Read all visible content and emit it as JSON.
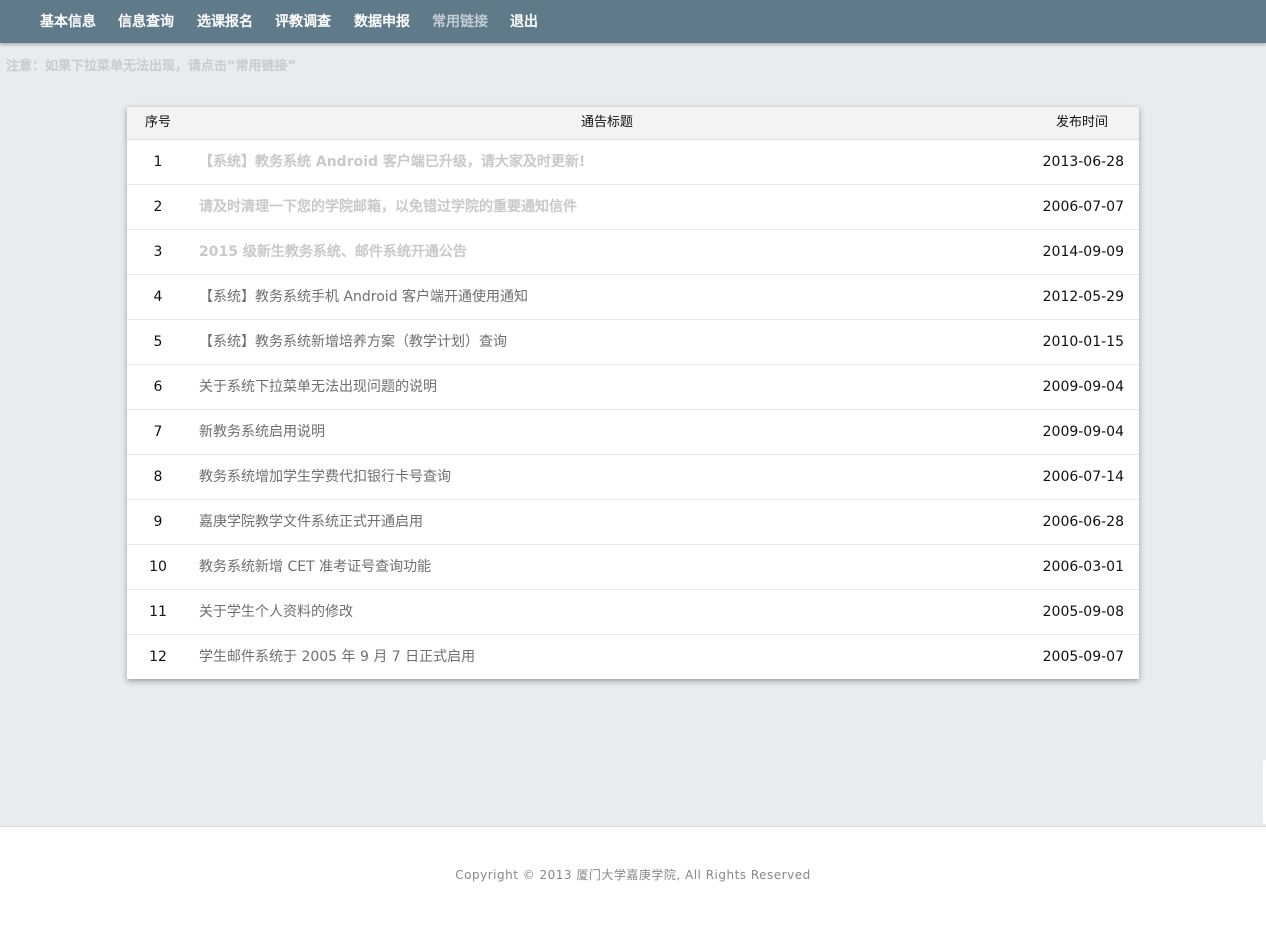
{
  "nav": {
    "items": [
      {
        "label": "基本信息",
        "muted": false
      },
      {
        "label": "信息查询",
        "muted": false
      },
      {
        "label": "选课报名",
        "muted": false
      },
      {
        "label": "评教调查",
        "muted": false
      },
      {
        "label": "数据申报",
        "muted": false
      },
      {
        "label": "常用链接",
        "muted": true
      },
      {
        "label": "退出",
        "muted": false
      }
    ]
  },
  "notice": "注意：如果下拉菜单无法出现，请点击“常用链接”",
  "table": {
    "headers": {
      "num": "序号",
      "title": "通告标题",
      "date": "发布时间"
    },
    "rows": [
      {
        "num": "1",
        "title": "【系统】教务系统 Android 客户端已升级，请大家及时更新!",
        "date": "2013-06-28",
        "faded": true
      },
      {
        "num": "2",
        "title": "请及时清理一下您的学院邮箱，以免错过学院的重要通知信件",
        "date": "2006-07-07",
        "faded": true
      },
      {
        "num": "3",
        "title": "2015 级新生教务系统、邮件系统开通公告",
        "date": "2014-09-09",
        "faded": true
      },
      {
        "num": "4",
        "title": "【系统】教务系统手机 Android 客户端开通使用通知",
        "date": "2012-05-29",
        "faded": false
      },
      {
        "num": "5",
        "title": "【系统】教务系统新增培养方案（教学计划）查询",
        "date": "2010-01-15",
        "faded": false
      },
      {
        "num": "6",
        "title": "关于系统下拉菜单无法出现问题的说明",
        "date": "2009-09-04",
        "faded": false
      },
      {
        "num": "7",
        "title": "新教务系统启用说明",
        "date": "2009-09-04",
        "faded": false
      },
      {
        "num": "8",
        "title": "教务系统增加学生学费代扣银行卡号查询",
        "date": "2006-07-14",
        "faded": false
      },
      {
        "num": "9",
        "title": "嘉庚学院教学文件系统正式开通启用",
        "date": "2006-06-28",
        "faded": false
      },
      {
        "num": "10",
        "title": "教务系统新增 CET 准考证号查询功能",
        "date": "2006-03-01",
        "faded": false
      },
      {
        "num": "11",
        "title": "关于学生个人资料的修改",
        "date": "2005-09-08",
        "faded": false
      },
      {
        "num": "12",
        "title": "学生邮件系统于 2005 年 9 月 7 日正式启用",
        "date": "2005-09-07",
        "faded": false
      }
    ]
  },
  "footer": "Copyright © 2013 厦门大学嘉庚学院, All Rights Reserved",
  "colors": {
    "navbar": "#5f7a89",
    "page_background": "#e8ecef",
    "link_text": "#6f6f6f",
    "visited_link_text": "#c9c9c9"
  }
}
